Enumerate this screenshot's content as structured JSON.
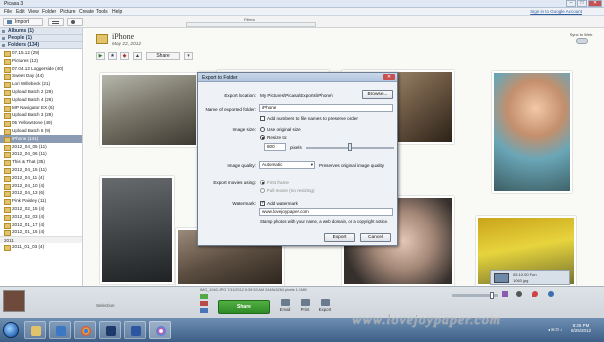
{
  "window": {
    "title": "Picasa 3",
    "min_label": "–",
    "max_label": "□",
    "close_label": "✕"
  },
  "menu": {
    "items": [
      "File",
      "Edit",
      "View",
      "Folder",
      "Picture",
      "Create",
      "Tools",
      "Help"
    ],
    "signin": "Sign in to Google Account"
  },
  "toolbar": {
    "import_label": "Import"
  },
  "filters": {
    "label": "Filters"
  },
  "sidebar": {
    "groups": [
      {
        "label": "Albums (1)"
      },
      {
        "label": "People (1)"
      },
      {
        "label": "Folders (134)"
      }
    ],
    "folders": [
      "07.15.12 (29)",
      "Pictures (12)",
      "07.04.12 Loggerside (40)",
      "Sweet Day (44)",
      "Lori Willebeck (21)",
      "Upload Batch 2 (29)",
      "Upload Batch 4 (26)",
      "MP Navigator EX (6)",
      "Upload Batch 3 (29)",
      "05 Yellowstone (49)",
      "Upload Batch 5 (9)",
      "iPhone (141)",
      "2012_04_05 (11)",
      "2012_04_06 (11)",
      "This & That (35)",
      "2012_04_15 (11)",
      "2012_04_11 (4)",
      "2012_04_10 (4)",
      "2012_04_13 (6)",
      "Pink Paisley (11)",
      "2012_02_15 (4)",
      "2012_02_03 (4)",
      "2012_01_17 (4)",
      "2012_01_15 (4)"
    ],
    "selected_index": 11,
    "year_label": "2011",
    "last_folder": "2011_01_03 (4)"
  },
  "album": {
    "name": "iPhone",
    "date": "May 22, 2012",
    "share_label": "Share",
    "sync_label": "Sync to Web"
  },
  "dialog": {
    "title": "Export to Folder",
    "close_label": "✕",
    "export_location_label": "Export location:",
    "export_location_value": "My Pictures\\Picasa\\Exports\\iPhone\\",
    "browse_label": "Browse...",
    "folder_name_label": "Name of exported folder:",
    "folder_name_value": "iPhone",
    "add_numbers_label": "Add numbers to file names to preserve order",
    "image_size_label": "Image size:",
    "use_original_label": "Use original size",
    "resize_label": "Resize to:",
    "resize_value": "800",
    "pixels_label": "pixels",
    "image_quality_label": "Image quality:",
    "image_quality_value": "Automatic",
    "image_quality_note": "Preserves original image quality",
    "export_movies_label": "Export movies using:",
    "first_frame_label": "First frame",
    "full_movie_label": "Full movie (no resizing)",
    "watermark_label": "Watermark:",
    "add_watermark_label": "Add watermark",
    "watermark_value": "www.lovejoypaper.com",
    "watermark_hint": "Stamp photos with your name, a web domain, or a copyright notice.",
    "export_button": "Export",
    "cancel_button": "Cancel"
  },
  "statusbar": {
    "info": "IMG_1040.JPG   7/11/2012 6:39:53 AM   2448x3264 pixels   1.1MB",
    "selection_label": "Selection",
    "share_button": "Share",
    "actions": [
      "Email",
      "Print",
      "Export"
    ]
  },
  "filmthumb": {
    "text": "05.10.00 Fun",
    "count": "1063 jpg"
  },
  "taskbar": {
    "time": "8:26 PM",
    "date": "8/25/2012",
    "tray": "◂ ✉ ⊡ ♪"
  },
  "watermark_overlay": "www.lovejoypaper.com"
}
